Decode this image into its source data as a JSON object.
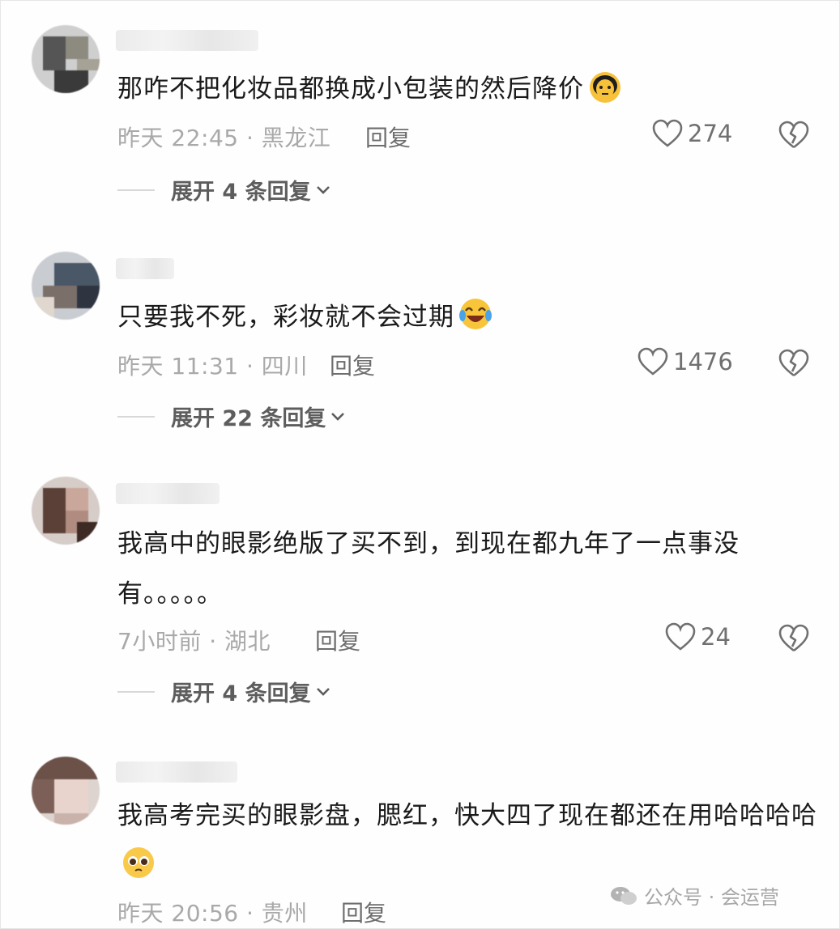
{
  "comments": [
    {
      "text": "那咋不把化妆品都换成小包装的然后降价",
      "emoji": "worried-face-emoji",
      "meta": "昨天 22:45 · 黑龙江",
      "reply": "回复",
      "likes": "274",
      "expand": "展开 4 条回复"
    },
    {
      "text": "只要我不死，彩妆就不会过期",
      "emoji": "laughing-crying-emoji",
      "meta": "昨天 11:31 · 四川",
      "reply": "回复",
      "likes": "1476",
      "expand": "展开 22 条回复"
    },
    {
      "text": "我高中的眼影绝版了买不到，到现在都九年了一点事没有。。。。。",
      "emoji": "",
      "meta": "7小时前 · 湖北",
      "reply": "回复",
      "likes": "24",
      "expand": "展开 4 条回复"
    },
    {
      "text": "我高考完买的眼影盘，腮红，快大四了现在都还在用哈哈哈哈",
      "emoji": "pleading-face-emoji",
      "meta": "昨天 20:56 · 贵州",
      "reply": "回复",
      "likes": "",
      "expand": ""
    }
  ],
  "watermark": "公众号 · 会运营",
  "colors": {
    "text": "#1a1a1a",
    "meta": "#a9a9a9",
    "icon": "#707070"
  }
}
